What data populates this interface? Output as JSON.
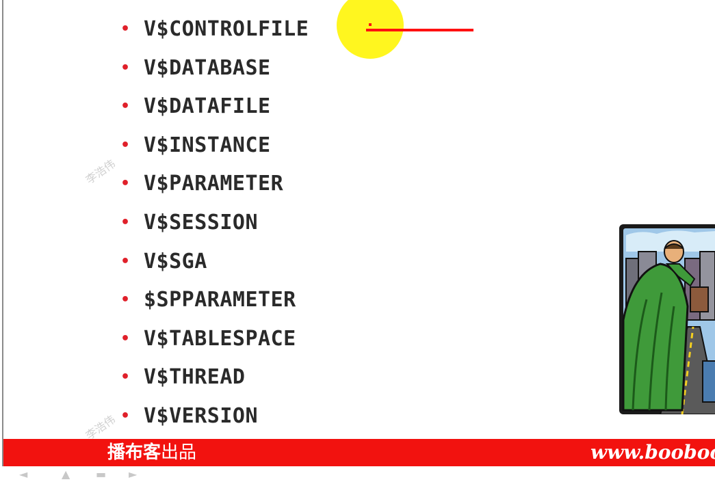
{
  "slide": {
    "items": [
      "V$CONTROLFILE",
      "V$DATABASE",
      "V$DATAFILE",
      "V$INSTANCE",
      "V$PARAMETER",
      "V$SESSION",
      "V$SGA",
      "$SPPARAMETER",
      "V$TABLESPACE",
      "V$THREAD",
      "V$VERSION"
    ],
    "bullet_glyph": "•",
    "bullet_color": "#e0202a"
  },
  "watermark": {
    "text": "李浩伟"
  },
  "footer": {
    "brand_bold": "播布客",
    "brand_light": "出品",
    "url": "www.booboo",
    "bar_color": "#f2120f"
  },
  "icons": {
    "clipart": "city-street-illustration",
    "cursor": "yellow-cursor-highlight",
    "pointer": "red-pointer-line"
  }
}
